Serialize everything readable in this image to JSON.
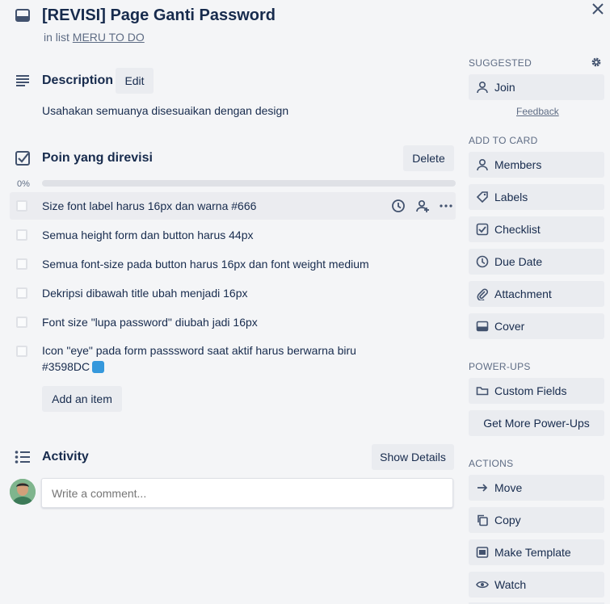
{
  "card": {
    "title": "[REVISI] Page Ganti Password",
    "in_list_prefix": "in list",
    "list_name": "MERU TO DO"
  },
  "description": {
    "heading": "Description",
    "edit_label": "Edit",
    "text": "Usahakan semuanya disesuaikan dengan design"
  },
  "checklist": {
    "title": "Poin yang direvisi",
    "delete_label": "Delete",
    "progress_text": "0%",
    "progress": 0,
    "items": [
      {
        "text": "Size font label harus 16px dan warna #666",
        "checked": false
      },
      {
        "text": "Semua height form dan button harus 44px",
        "checked": false
      },
      {
        "text": "Semua font-size pada button harus 16px dan font weight medium",
        "checked": false
      },
      {
        "text": "Dekripsi dibawah title ubah menjadi 16px",
        "checked": false
      },
      {
        "text": "Font size \"lupa password\" diubah jadi 16px",
        "checked": false
      },
      {
        "text": "Icon \"eye\" pada form passsword saat aktif harus berwarna biru",
        "text_line2": "#3598DC",
        "checked": false
      }
    ],
    "add_item_label": "Add an item"
  },
  "activity": {
    "heading": "Activity",
    "show_details_label": "Show Details",
    "comment_placeholder": "Write a comment..."
  },
  "sidebar": {
    "suggested": {
      "label": "SUGGESTED",
      "join_label": "Join",
      "feedback_label": "Feedback"
    },
    "add_to_card": {
      "label": "ADD TO CARD",
      "items": [
        {
          "label": "Members",
          "icon": "person-icon"
        },
        {
          "label": "Labels",
          "icon": "tag-icon"
        },
        {
          "label": "Checklist",
          "icon": "checklist-icon"
        },
        {
          "label": "Due Date",
          "icon": "clock-icon"
        },
        {
          "label": "Attachment",
          "icon": "paperclip-icon"
        },
        {
          "label": "Cover",
          "icon": "cover-icon"
        }
      ]
    },
    "power_ups": {
      "label": "POWER-UPS",
      "custom_fields_label": "Custom Fields",
      "get_more_label": "Get More Power-Ups"
    },
    "actions": {
      "label": "ACTIONS",
      "items": [
        {
          "label": "Move",
          "icon": "arrow-right-icon"
        },
        {
          "label": "Copy",
          "icon": "copy-icon"
        },
        {
          "label": "Make Template",
          "icon": "template-icon"
        },
        {
          "label": "Watch",
          "icon": "eye-icon"
        }
      ]
    }
  },
  "colors": {
    "background": "#f4f5f7",
    "button": "#eaecf0",
    "text": "#172b4d",
    "muted": "#5e6c84",
    "swatch": "#3598DC"
  }
}
